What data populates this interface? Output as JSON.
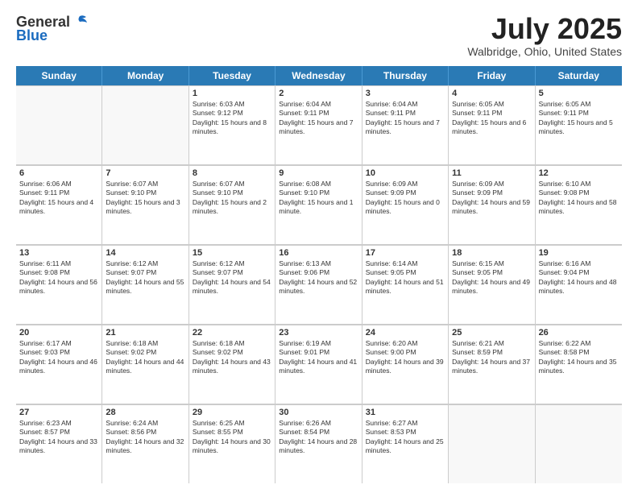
{
  "header": {
    "logo_line1": "General",
    "logo_line2": "Blue",
    "title": "July 2025",
    "subtitle": "Walbridge, Ohio, United States"
  },
  "weekdays": [
    "Sunday",
    "Monday",
    "Tuesday",
    "Wednesday",
    "Thursday",
    "Friday",
    "Saturday"
  ],
  "weeks": [
    [
      {
        "day": "",
        "sunrise": "",
        "sunset": "",
        "daylight": ""
      },
      {
        "day": "",
        "sunrise": "",
        "sunset": "",
        "daylight": ""
      },
      {
        "day": "1",
        "sunrise": "Sunrise: 6:03 AM",
        "sunset": "Sunset: 9:12 PM",
        "daylight": "Daylight: 15 hours and 8 minutes."
      },
      {
        "day": "2",
        "sunrise": "Sunrise: 6:04 AM",
        "sunset": "Sunset: 9:11 PM",
        "daylight": "Daylight: 15 hours and 7 minutes."
      },
      {
        "day": "3",
        "sunrise": "Sunrise: 6:04 AM",
        "sunset": "Sunset: 9:11 PM",
        "daylight": "Daylight: 15 hours and 7 minutes."
      },
      {
        "day": "4",
        "sunrise": "Sunrise: 6:05 AM",
        "sunset": "Sunset: 9:11 PM",
        "daylight": "Daylight: 15 hours and 6 minutes."
      },
      {
        "day": "5",
        "sunrise": "Sunrise: 6:05 AM",
        "sunset": "Sunset: 9:11 PM",
        "daylight": "Daylight: 15 hours and 5 minutes."
      }
    ],
    [
      {
        "day": "6",
        "sunrise": "Sunrise: 6:06 AM",
        "sunset": "Sunset: 9:11 PM",
        "daylight": "Daylight: 15 hours and 4 minutes."
      },
      {
        "day": "7",
        "sunrise": "Sunrise: 6:07 AM",
        "sunset": "Sunset: 9:10 PM",
        "daylight": "Daylight: 15 hours and 3 minutes."
      },
      {
        "day": "8",
        "sunrise": "Sunrise: 6:07 AM",
        "sunset": "Sunset: 9:10 PM",
        "daylight": "Daylight: 15 hours and 2 minutes."
      },
      {
        "day": "9",
        "sunrise": "Sunrise: 6:08 AM",
        "sunset": "Sunset: 9:10 PM",
        "daylight": "Daylight: 15 hours and 1 minute."
      },
      {
        "day": "10",
        "sunrise": "Sunrise: 6:09 AM",
        "sunset": "Sunset: 9:09 PM",
        "daylight": "Daylight: 15 hours and 0 minutes."
      },
      {
        "day": "11",
        "sunrise": "Sunrise: 6:09 AM",
        "sunset": "Sunset: 9:09 PM",
        "daylight": "Daylight: 14 hours and 59 minutes."
      },
      {
        "day": "12",
        "sunrise": "Sunrise: 6:10 AM",
        "sunset": "Sunset: 9:08 PM",
        "daylight": "Daylight: 14 hours and 58 minutes."
      }
    ],
    [
      {
        "day": "13",
        "sunrise": "Sunrise: 6:11 AM",
        "sunset": "Sunset: 9:08 PM",
        "daylight": "Daylight: 14 hours and 56 minutes."
      },
      {
        "day": "14",
        "sunrise": "Sunrise: 6:12 AM",
        "sunset": "Sunset: 9:07 PM",
        "daylight": "Daylight: 14 hours and 55 minutes."
      },
      {
        "day": "15",
        "sunrise": "Sunrise: 6:12 AM",
        "sunset": "Sunset: 9:07 PM",
        "daylight": "Daylight: 14 hours and 54 minutes."
      },
      {
        "day": "16",
        "sunrise": "Sunrise: 6:13 AM",
        "sunset": "Sunset: 9:06 PM",
        "daylight": "Daylight: 14 hours and 52 minutes."
      },
      {
        "day": "17",
        "sunrise": "Sunrise: 6:14 AM",
        "sunset": "Sunset: 9:05 PM",
        "daylight": "Daylight: 14 hours and 51 minutes."
      },
      {
        "day": "18",
        "sunrise": "Sunrise: 6:15 AM",
        "sunset": "Sunset: 9:05 PM",
        "daylight": "Daylight: 14 hours and 49 minutes."
      },
      {
        "day": "19",
        "sunrise": "Sunrise: 6:16 AM",
        "sunset": "Sunset: 9:04 PM",
        "daylight": "Daylight: 14 hours and 48 minutes."
      }
    ],
    [
      {
        "day": "20",
        "sunrise": "Sunrise: 6:17 AM",
        "sunset": "Sunset: 9:03 PM",
        "daylight": "Daylight: 14 hours and 46 minutes."
      },
      {
        "day": "21",
        "sunrise": "Sunrise: 6:18 AM",
        "sunset": "Sunset: 9:02 PM",
        "daylight": "Daylight: 14 hours and 44 minutes."
      },
      {
        "day": "22",
        "sunrise": "Sunrise: 6:18 AM",
        "sunset": "Sunset: 9:02 PM",
        "daylight": "Daylight: 14 hours and 43 minutes."
      },
      {
        "day": "23",
        "sunrise": "Sunrise: 6:19 AM",
        "sunset": "Sunset: 9:01 PM",
        "daylight": "Daylight: 14 hours and 41 minutes."
      },
      {
        "day": "24",
        "sunrise": "Sunrise: 6:20 AM",
        "sunset": "Sunset: 9:00 PM",
        "daylight": "Daylight: 14 hours and 39 minutes."
      },
      {
        "day": "25",
        "sunrise": "Sunrise: 6:21 AM",
        "sunset": "Sunset: 8:59 PM",
        "daylight": "Daylight: 14 hours and 37 minutes."
      },
      {
        "day": "26",
        "sunrise": "Sunrise: 6:22 AM",
        "sunset": "Sunset: 8:58 PM",
        "daylight": "Daylight: 14 hours and 35 minutes."
      }
    ],
    [
      {
        "day": "27",
        "sunrise": "Sunrise: 6:23 AM",
        "sunset": "Sunset: 8:57 PM",
        "daylight": "Daylight: 14 hours and 33 minutes."
      },
      {
        "day": "28",
        "sunrise": "Sunrise: 6:24 AM",
        "sunset": "Sunset: 8:56 PM",
        "daylight": "Daylight: 14 hours and 32 minutes."
      },
      {
        "day": "29",
        "sunrise": "Sunrise: 6:25 AM",
        "sunset": "Sunset: 8:55 PM",
        "daylight": "Daylight: 14 hours and 30 minutes."
      },
      {
        "day": "30",
        "sunrise": "Sunrise: 6:26 AM",
        "sunset": "Sunset: 8:54 PM",
        "daylight": "Daylight: 14 hours and 28 minutes."
      },
      {
        "day": "31",
        "sunrise": "Sunrise: 6:27 AM",
        "sunset": "Sunset: 8:53 PM",
        "daylight": "Daylight: 14 hours and 25 minutes."
      },
      {
        "day": "",
        "sunrise": "",
        "sunset": "",
        "daylight": ""
      },
      {
        "day": "",
        "sunrise": "",
        "sunset": "",
        "daylight": ""
      }
    ]
  ]
}
